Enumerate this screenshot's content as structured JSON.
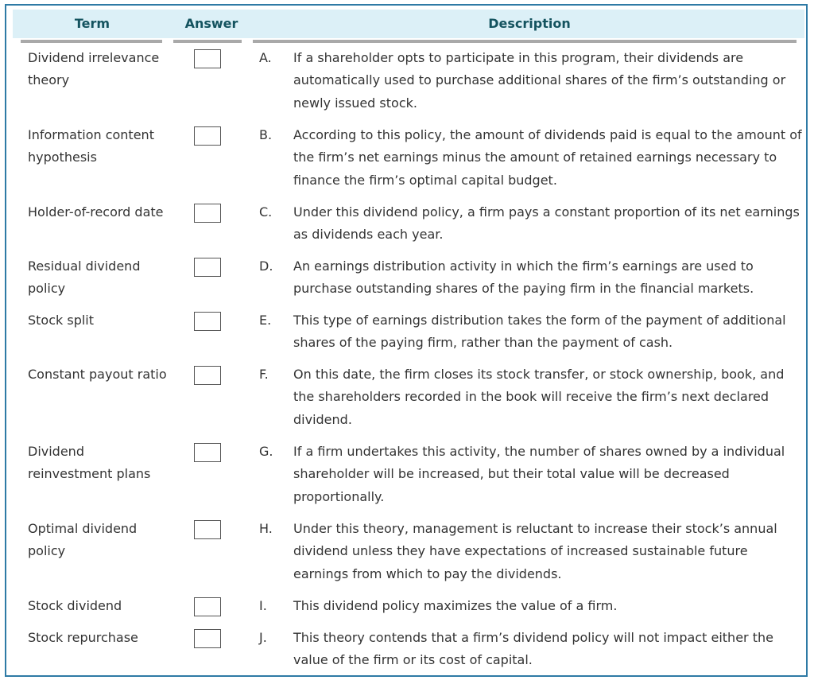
{
  "headers": {
    "term": "Term",
    "answer": "Answer",
    "description": "Description"
  },
  "terms": [
    {
      "label": "Dividend irrelevance theory",
      "answer": ""
    },
    {
      "label": "Information content hypothesis",
      "answer": ""
    },
    {
      "label": "Holder-of-record date",
      "answer": ""
    },
    {
      "label": "Residual dividend policy",
      "answer": ""
    },
    {
      "label": "Stock split",
      "answer": ""
    },
    {
      "label": "Constant payout ratio",
      "answer": ""
    },
    {
      "label": "Dividend reinvestment plans",
      "answer": ""
    },
    {
      "label": "Optimal dividend policy",
      "answer": ""
    },
    {
      "label": "Stock dividend",
      "answer": ""
    },
    {
      "label": "Stock repurchase",
      "answer": ""
    }
  ],
  "descriptions": [
    {
      "letter": "A.",
      "text": "If a shareholder opts to participate in this program, their dividends are automatically used to purchase additional shares of the firm’s outstanding or newly issued stock."
    },
    {
      "letter": "B.",
      "text": "According to this policy, the amount of dividends paid is equal to the amount of the firm’s net earnings minus the amount of retained earnings necessary to finance the firm’s optimal capital budget."
    },
    {
      "letter": "C.",
      "text": "Under this dividend policy, a firm pays a constant proportion of its net earnings as dividends each year."
    },
    {
      "letter": "D.",
      "text": "An earnings distribution activity in which the firm’s earnings are used to purchase outstanding shares of the paying firm in the financial markets."
    },
    {
      "letter": "E.",
      "text": "This type of earnings distribution takes the form of the payment of additional shares of the paying firm, rather than the payment of cash."
    },
    {
      "letter": "F.",
      "text": "On this date, the firm closes its stock transfer, or stock ownership, book, and the shareholders recorded in the book will receive the firm’s next declared dividend."
    },
    {
      "letter": "G.",
      "text": "If a firm undertakes this activity, the number of shares owned by a individual shareholder will be increased, but their total value will be decreased proportionally."
    },
    {
      "letter": "H.",
      "text": "Under this theory, management is reluctant to increase their stock’s annual dividend unless they have expectations of increased sustainable future earnings from which to pay the dividends."
    },
    {
      "letter": "I.",
      "text": "This dividend policy maximizes the value of a firm."
    },
    {
      "letter": "J.",
      "text": "This theory contends that a firm’s dividend policy will not impact either the value of the firm or its cost of capital."
    }
  ]
}
